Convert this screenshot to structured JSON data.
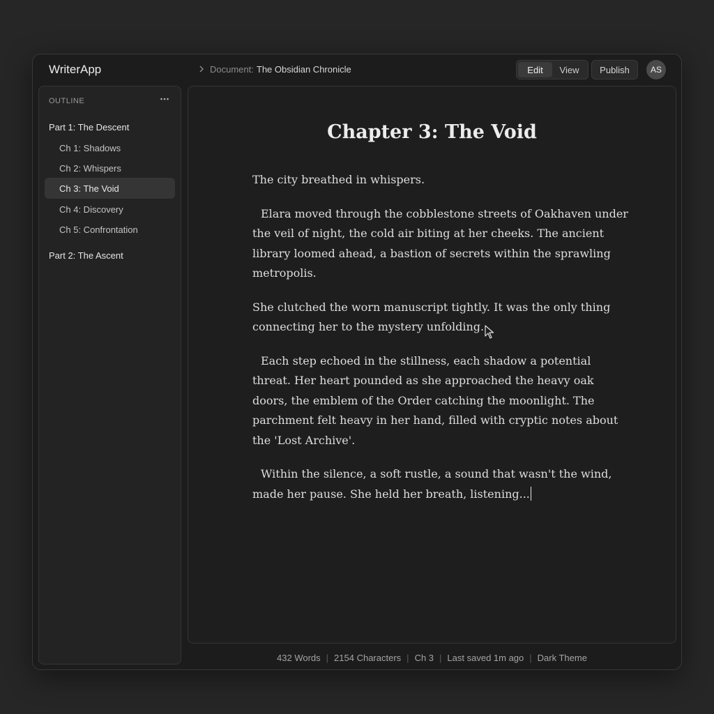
{
  "header": {
    "app_name": "WriterApp",
    "breadcrumb_label": "Document:",
    "document_name": "The Obsidian Chronicle",
    "mode_edit": "Edit",
    "mode_view": "View",
    "active_mode": "Edit",
    "publish_label": "Publish",
    "avatar_initials": "AS"
  },
  "sidebar": {
    "title": "OUTLINE",
    "more_icon": "more-horizontal-icon",
    "items": [
      {
        "label": "Part 1: The Descent",
        "kind": "part"
      },
      {
        "label": "Ch 1: Shadows",
        "kind": "chapter"
      },
      {
        "label": "Ch 2: Whispers",
        "kind": "chapter"
      },
      {
        "label": "Ch 3: The Void",
        "kind": "chapter",
        "active": true
      },
      {
        "label": "Ch 4: Discovery",
        "kind": "chapter"
      },
      {
        "label": "Ch 5: Confrontation",
        "kind": "chapter"
      },
      {
        "label": "Part 2: The Ascent",
        "kind": "part"
      }
    ]
  },
  "editor": {
    "chapter_title": "Chapter 3: The Void",
    "paragraphs": [
      "The city breathed in whispers.",
      "Elara moved through the cobblestone streets of Oakhaven under the veil of night, the cold air biting at her cheeks. The ancient library loomed ahead, a bastion of secrets within the sprawling metropolis.",
      "She clutched the worn manuscript tightly. It was the only thing connecting her to the mystery unfolding.",
      "Each step echoed in the stillness, each shadow a potential threat. Her heart pounded as she approached the heavy oak doors, the emblem of the Order catching the moonlight. The parchment felt heavy in her hand, filled with cryptic notes about the 'Lost Archive'.",
      "Within the silence, a soft rustle, a sound that wasn't the wind, made her pause. She held her breath, listening..."
    ]
  },
  "status": {
    "words": "432 Words",
    "characters": "2154 Characters",
    "chapter": "Ch 3",
    "saved": "Last saved 1m ago",
    "theme": "Dark Theme"
  },
  "colors": {
    "background": "#262626",
    "window": "#1c1c1c",
    "text": "#dedede"
  }
}
